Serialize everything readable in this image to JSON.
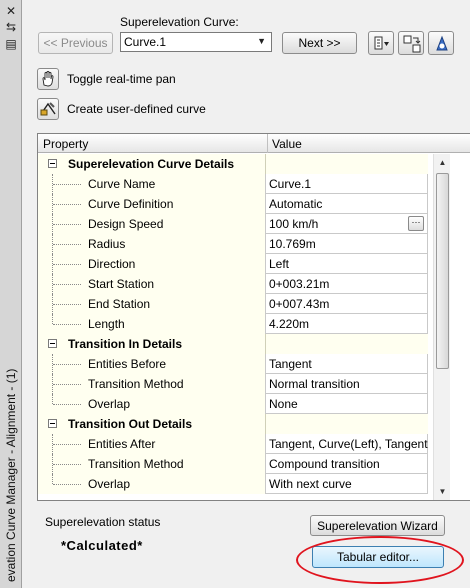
{
  "palette": {
    "title": "evation Curve Manager - Alignment - (1)",
    "icons": [
      "close-icon",
      "autohide-icon",
      "properties-icon"
    ]
  },
  "header": {
    "curve_label": "Superelevation Curve:",
    "previous_label": "<< Previous",
    "next_label": "Next >>",
    "curve_selected": "Curve.1"
  },
  "toolbar": {
    "icons": [
      "selection-filter-icon",
      "zoom-to-curve-icon",
      "pick-curve-icon"
    ]
  },
  "actions": {
    "toggle_pan": "Toggle real-time pan",
    "create_curve": "Create user-defined curve"
  },
  "grid": {
    "col_property": "Property",
    "col_value": "Value",
    "rows": [
      {
        "type": "cat",
        "label": "Superelevation Curve Details",
        "value": ""
      },
      {
        "type": "item",
        "label": "Curve Name",
        "value": "Curve.1"
      },
      {
        "type": "item",
        "label": "Curve Definition",
        "value": "Automatic"
      },
      {
        "type": "item",
        "label": "Design Speed",
        "value": "100 km/h",
        "ellipsis": true
      },
      {
        "type": "item",
        "label": "Radius",
        "value": "10.769m"
      },
      {
        "type": "item",
        "label": "Direction",
        "value": "Left"
      },
      {
        "type": "item",
        "label": "Start Station",
        "value": "0+003.21m"
      },
      {
        "type": "item",
        "label": "End Station",
        "value": "0+007.43m"
      },
      {
        "type": "item",
        "label": "Length",
        "value": "4.220m"
      },
      {
        "type": "cat",
        "label": "Transition In Details",
        "value": ""
      },
      {
        "type": "item",
        "label": "Entities Before",
        "value": "Tangent"
      },
      {
        "type": "item",
        "label": "Transition Method",
        "value": "Normal transition"
      },
      {
        "type": "item",
        "label": "Overlap",
        "value": "None"
      },
      {
        "type": "cat",
        "label": "Transition Out Details",
        "value": ""
      },
      {
        "type": "item",
        "label": "Entities After",
        "value": "Tangent, Curve(Left), Tangent"
      },
      {
        "type": "item",
        "label": "Transition Method",
        "value": "Compound transition"
      },
      {
        "type": "item",
        "label": "Overlap",
        "value": "With next curve"
      }
    ]
  },
  "footer": {
    "status_label": "Superelevation status",
    "status_value": "*Calculated*",
    "wizard_label": "Superelevation Wizard",
    "tabular_label": "Tabular editor..."
  },
  "colors": {
    "highlight_ellipse": "#e0141e",
    "category_background": "#fffff0"
  }
}
